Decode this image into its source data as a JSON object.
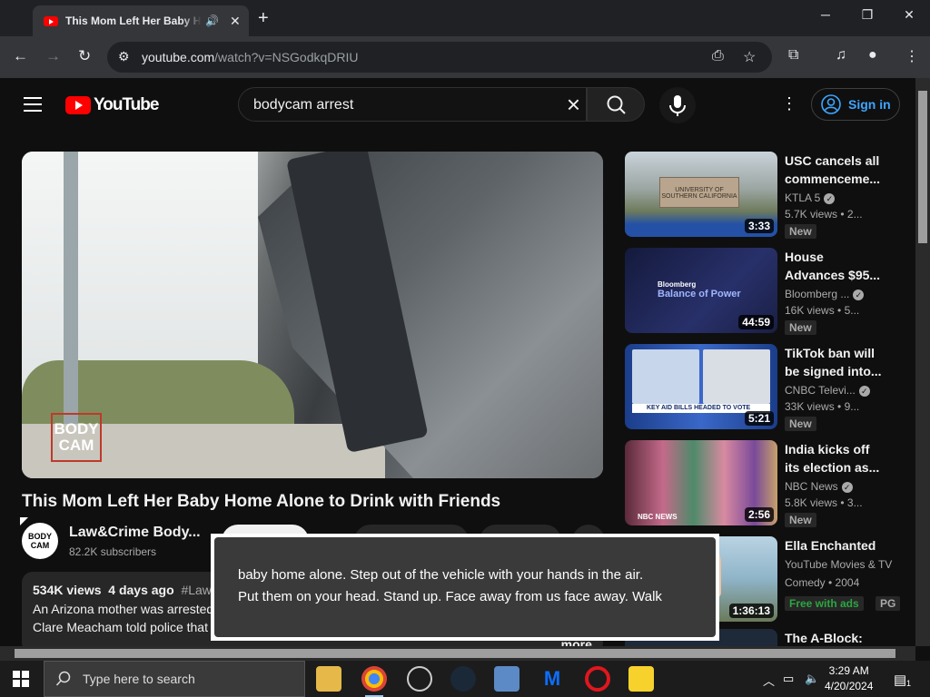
{
  "browser": {
    "tab_title": "This Mom Left Her Baby Home Alone to Drink with Friends",
    "url_host": "youtube.com",
    "url_path": "/watch?v=NSGodkqDRIU"
  },
  "header": {
    "logo_text": "YouTube",
    "search_query": "bodycam arrest",
    "sign_in_label": "Sign in"
  },
  "video": {
    "overlay_logo": "BODY CAM",
    "title": "This Mom Left Her Baby Home Alone to Drink with Friends",
    "channel_name": "Law&Crime Body...",
    "channel_subs": "82.2K subscribers",
    "avatar_text": "BODY CAM",
    "views": "534K views",
    "age": "4 days ago",
    "hashtag": "#Lawa",
    "description": "An Arizona mother was arrested stopped in the middle of traffic, performing field sobriety tests. Clare Meacham told police that officers needed to go get her",
    "more": "...more"
  },
  "captions": {
    "line1": "baby home alone. Step out of the vehicle with your hands in the air.",
    "line2": "Put them on your head. Stand up. Face away from us face away. Walk"
  },
  "recommendations": [
    {
      "title": "USC cancels all commenceme...",
      "channel": "KTLA 5",
      "views": "5.7K views",
      "age": "2...",
      "duration": "3:33",
      "badge": "New",
      "thumb_color": "#7a8a94"
    },
    {
      "title": "House Advances $95...",
      "channel": "Bloomberg ...",
      "views": "16K views",
      "age": "5...",
      "duration": "44:59",
      "badge": "New",
      "thumb_color": "#1c2350",
      "thumb_text": "Bloomberg Balance of Power"
    },
    {
      "title": "TikTok ban will be signed into...",
      "channel": "CNBC Televi...",
      "views": "33K views",
      "age": "9...",
      "duration": "5:21",
      "badge": "New",
      "thumb_color": "#1f4aa8",
      "thumb_text": "KEY AID BILLS HEADED TO VOTE"
    },
    {
      "title": "India kicks off its election as...",
      "channel": "NBC News",
      "views": "5.8K views",
      "age": "3...",
      "duration": "2:56",
      "badge": "New",
      "thumb_color": "#a8566c",
      "thumb_text": "NBC NEWS"
    },
    {
      "title": "Ella Enchanted",
      "channel": "YouTube Movies & TV",
      "views": "Comedy • 2004",
      "duration": "1:36:13",
      "badge": "Free with ads",
      "badge2": "PG",
      "thumb_color": "#8fb4c8"
    },
    {
      "title": "The A-Block:"
    }
  ],
  "taskbar": {
    "search_placeholder": "Type here to search",
    "time": "3:29 AM",
    "date": "4/20/2024",
    "notifications": "1"
  }
}
